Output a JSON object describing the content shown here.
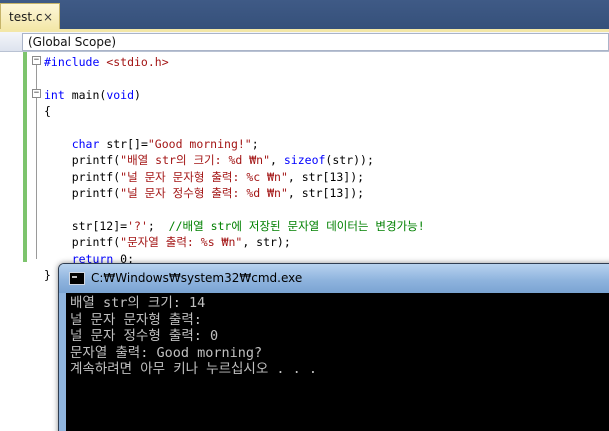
{
  "editor_tab": {
    "filename": "test.c",
    "close_glyph": "×"
  },
  "scope_bar": {
    "value": "(Global Scope)"
  },
  "fold_glyphs": {
    "collapse": "−"
  },
  "code_lines": [
    [
      {
        "t": "#include ",
        "c": "pp"
      },
      {
        "t": "<stdio.h>",
        "c": "ins"
      }
    ],
    [],
    [
      {
        "t": "int",
        "c": "kw"
      },
      {
        "t": " main(",
        "c": ""
      },
      {
        "t": "void",
        "c": "kw"
      },
      {
        "t": ")",
        "c": ""
      }
    ],
    [
      {
        "t": "{",
        "c": ""
      }
    ],
    [],
    [
      {
        "t": "    ",
        "c": ""
      },
      {
        "t": "char",
        "c": "kw"
      },
      {
        "t": " str[]=",
        "c": ""
      },
      {
        "t": "\"Good morning!\"",
        "c": "str"
      },
      {
        "t": ";",
        "c": ""
      }
    ],
    [
      {
        "t": "    printf(",
        "c": ""
      },
      {
        "t": "\"배열 str의 크기: %d ₩n\"",
        "c": "str"
      },
      {
        "t": ", ",
        "c": ""
      },
      {
        "t": "sizeof",
        "c": "kw"
      },
      {
        "t": "(str));",
        "c": ""
      }
    ],
    [
      {
        "t": "    printf(",
        "c": ""
      },
      {
        "t": "\"널 문자 문자형 출력: %c ₩n\"",
        "c": "str"
      },
      {
        "t": ", str[13]);",
        "c": ""
      }
    ],
    [
      {
        "t": "    printf(",
        "c": ""
      },
      {
        "t": "\"널 문자 정수형 출력: %d ₩n\"",
        "c": "str"
      },
      {
        "t": ", str[13]);",
        "c": ""
      }
    ],
    [],
    [
      {
        "t": "    str[12]=",
        "c": ""
      },
      {
        "t": "'?'",
        "c": "str"
      },
      {
        "t": ";  ",
        "c": ""
      },
      {
        "t": "//배열 str에 저장된 문자열 데이터는 변경가능!",
        "c": "cmt"
      }
    ],
    [
      {
        "t": "    printf(",
        "c": ""
      },
      {
        "t": "\"문자열 출력: %s ₩n\"",
        "c": "str"
      },
      {
        "t": ", str);",
        "c": ""
      }
    ],
    [
      {
        "t": "    ",
        "c": ""
      },
      {
        "t": "return",
        "c": "kw"
      },
      {
        "t": " 0;",
        "c": ""
      }
    ],
    [
      {
        "t": "}",
        "c": ""
      }
    ]
  ],
  "console": {
    "title": "C:₩Windows₩system32₩cmd.exe",
    "lines": [
      "배열 str의 크기: 14",
      "널 문자 문자형 출력: ",
      "널 문자 정수형 출력: 0",
      "문자열 출력: Good morning?",
      "계속하려면 아무 키나 누르십시오 . . ."
    ]
  },
  "icons": {
    "console_app_icon": "cmd-window-icon",
    "tab_close_icon": "close-icon",
    "fold_icon": "collapse-minus-icon"
  },
  "colors": {
    "keyword": "#0000ff",
    "string": "#a31515",
    "comment": "#008000",
    "console_bg": "#000000",
    "console_text": "#c0c0c0",
    "change_marker": "#7dc46d"
  }
}
